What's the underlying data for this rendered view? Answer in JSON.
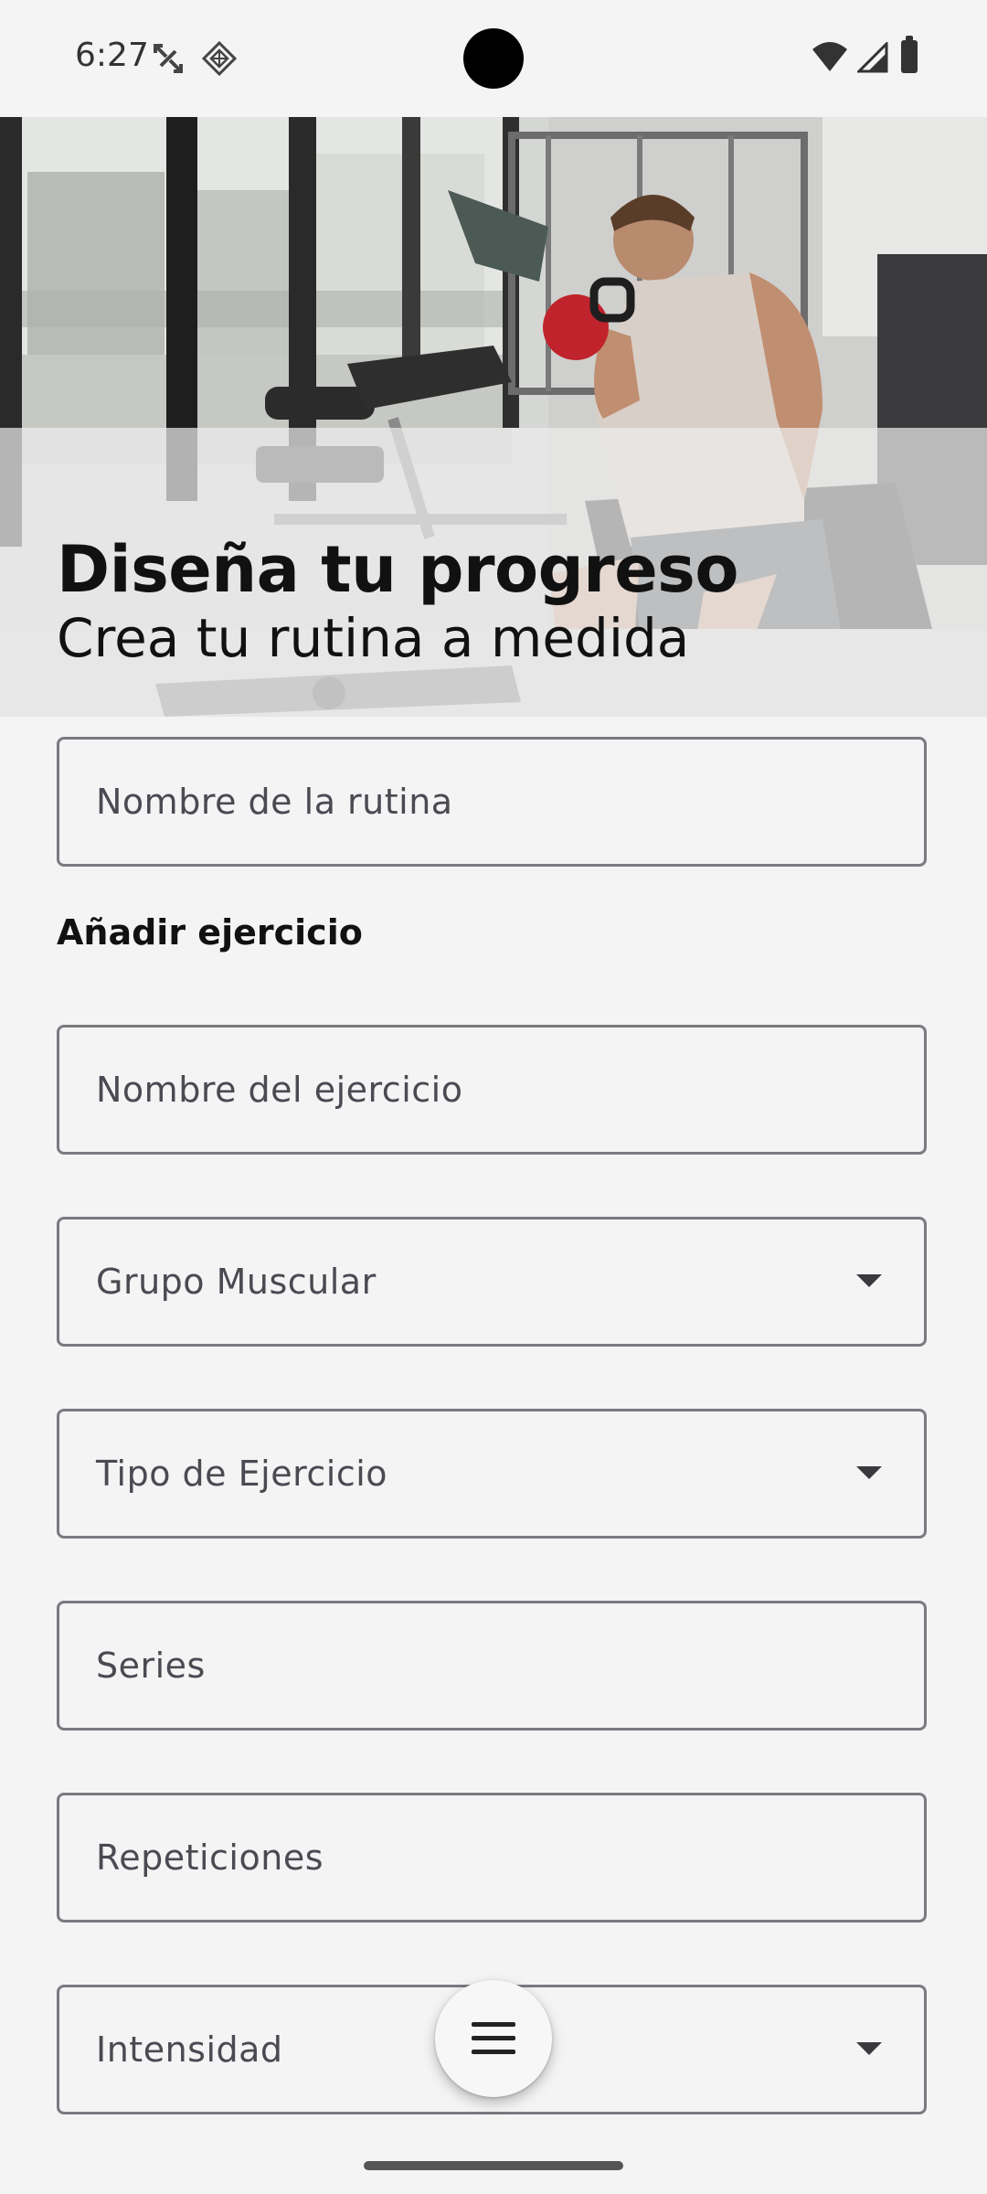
{
  "status_bar": {
    "time": "6:27",
    "icons": [
      "data-transfer-icon",
      "app-notification-icon",
      "wifi-icon",
      "signal-icon",
      "battery-icon"
    ]
  },
  "hero": {
    "title": "Diseña tu progreso",
    "subtitle": "Crea tu rutina a medida"
  },
  "form": {
    "routine_name_label": "Nombre de la rutina",
    "section_title": "Añadir ejercicio",
    "exercise_name_label": "Nombre del ejercicio",
    "muscle_group_label": "Grupo Muscular",
    "exercise_type_label": "Tipo de Ejercicio",
    "sets_label": "Series",
    "reps_label": "Repeticiones",
    "intensity_label": "Intensidad"
  },
  "fab": {
    "icon": "menu-icon"
  },
  "colors": {
    "background": "#f4f4f4",
    "field_border": "#7a7a80",
    "text_primary": "#111111",
    "label_text": "#4a4a52"
  }
}
